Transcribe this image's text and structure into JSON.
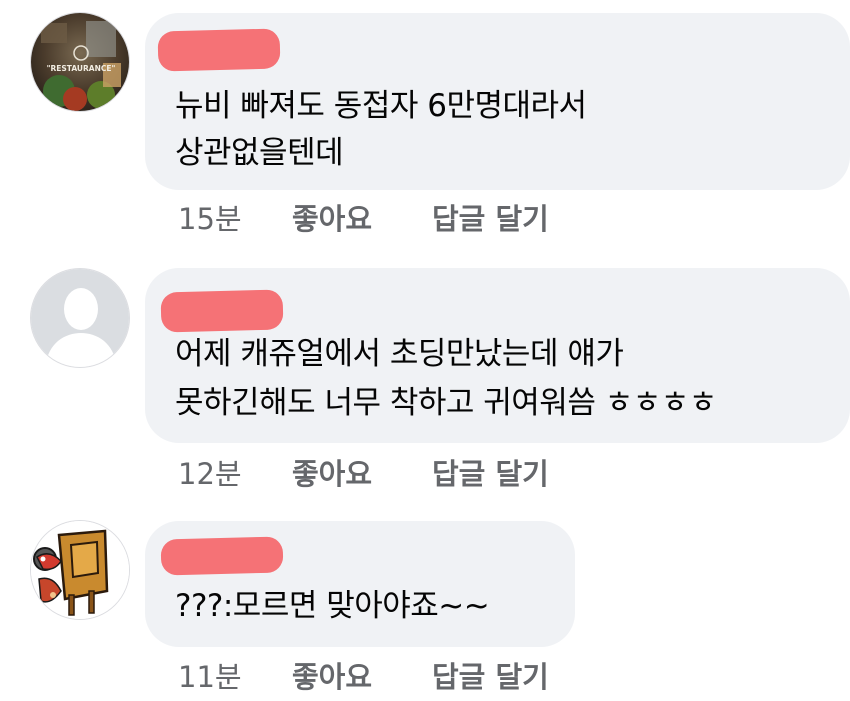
{
  "comments": [
    {
      "avatar": "restaurant-photo-avatar",
      "avatar_text": "\"RESTAURANCE\"",
      "author": "",
      "lines": [
        "뉴비 빠져도 동접자 6만명대라서",
        "상관없을텐데"
      ],
      "time": "15분",
      "like_label": "좋아요",
      "reply_label": "답글 달기"
    },
    {
      "avatar": "default-silhouette-avatar",
      "author": "",
      "lines": [
        "어제 캐쥬얼에서 초딩만났는데 얘가",
        "못하긴해도 너무 착하고 귀여워씀 ㅎㅎㅎㅎ"
      ],
      "time": "12분",
      "like_label": "좋아요",
      "reply_label": "답글 달기"
    },
    {
      "avatar": "cartoon-character-avatar",
      "author": "",
      "lines": [
        "???:모르면 맞아야죠~~"
      ],
      "time": "11분",
      "like_label": "좋아요",
      "reply_label": "답글 달기"
    }
  ],
  "colors": {
    "bubble": "#f0f2f5",
    "text": "#050505",
    "meta": "#65676b",
    "redaction": "#f46a6f"
  }
}
